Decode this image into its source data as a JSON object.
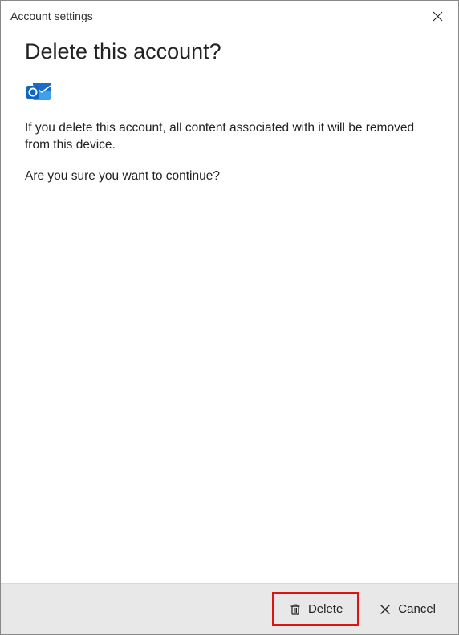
{
  "titlebar": {
    "title": "Account settings"
  },
  "main": {
    "heading": "Delete this account?",
    "body_line1": "If you delete this account, all content associated with it will be removed from this device.",
    "body_line2": "Are you sure you want to continue?"
  },
  "footer": {
    "delete_label": "Delete",
    "cancel_label": "Cancel"
  },
  "icons": {
    "app": "outlook-icon",
    "close": "close-icon",
    "trash": "trash-icon",
    "x": "x-icon"
  }
}
